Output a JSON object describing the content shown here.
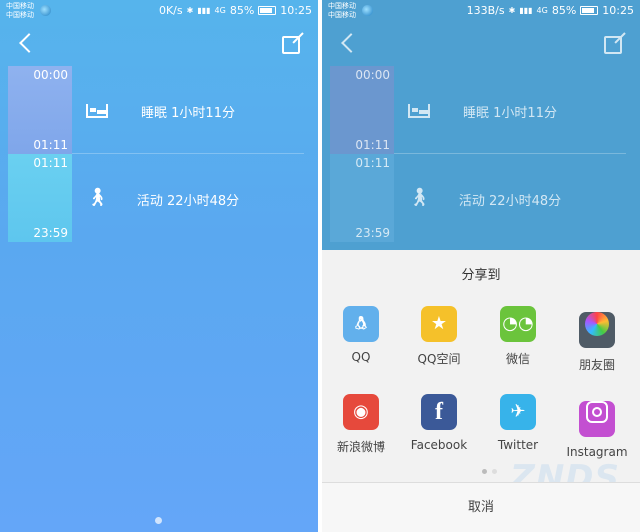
{
  "left": {
    "status": {
      "carrier1": "中国移动",
      "carrier2": "中国移动",
      "speed": "0K/s",
      "battery": "85%",
      "time": "10:25"
    },
    "timeline": {
      "sleep": {
        "start": "00:00",
        "end": "01:11",
        "label": "睡眠 1小时11分"
      },
      "activity": {
        "start": "01:11",
        "end": "23:59",
        "label": "活动 22小时48分"
      }
    }
  },
  "right": {
    "status": {
      "carrier1": "中国移动",
      "carrier2": "中国移动",
      "speed": "133B/s",
      "battery": "85%",
      "time": "10:25"
    },
    "timeline": {
      "sleep": {
        "start": "00:00",
        "end": "01:11",
        "label": "睡眠 1小时11分"
      },
      "activity": {
        "start": "01:11",
        "end": "23:59",
        "label": "活动 22小时48分"
      }
    },
    "share": {
      "title": "分享到",
      "apps": [
        {
          "label": "QQ",
          "icon": "qq-icon",
          "color": "#62b0ec"
        },
        {
          "label": "QQ空间",
          "icon": "qzone-icon",
          "color": "#f5c12a"
        },
        {
          "label": "微信",
          "icon": "wechat-icon",
          "color": "#6bc43c"
        },
        {
          "label": "朋友圈",
          "icon": "moments-icon",
          "color": "#4f5b66"
        },
        {
          "label": "新浪微博",
          "icon": "weibo-icon",
          "color": "#e6493c"
        },
        {
          "label": "Facebook",
          "icon": "facebook-icon",
          "color": "#3b5998"
        },
        {
          "label": "Twitter",
          "icon": "twitter-icon",
          "color": "#37b3ea"
        },
        {
          "label": "Instagram",
          "icon": "instagram-icon",
          "color": "#c34fd1"
        }
      ],
      "cancel": "取消"
    }
  },
  "watermark": "ZNDS"
}
